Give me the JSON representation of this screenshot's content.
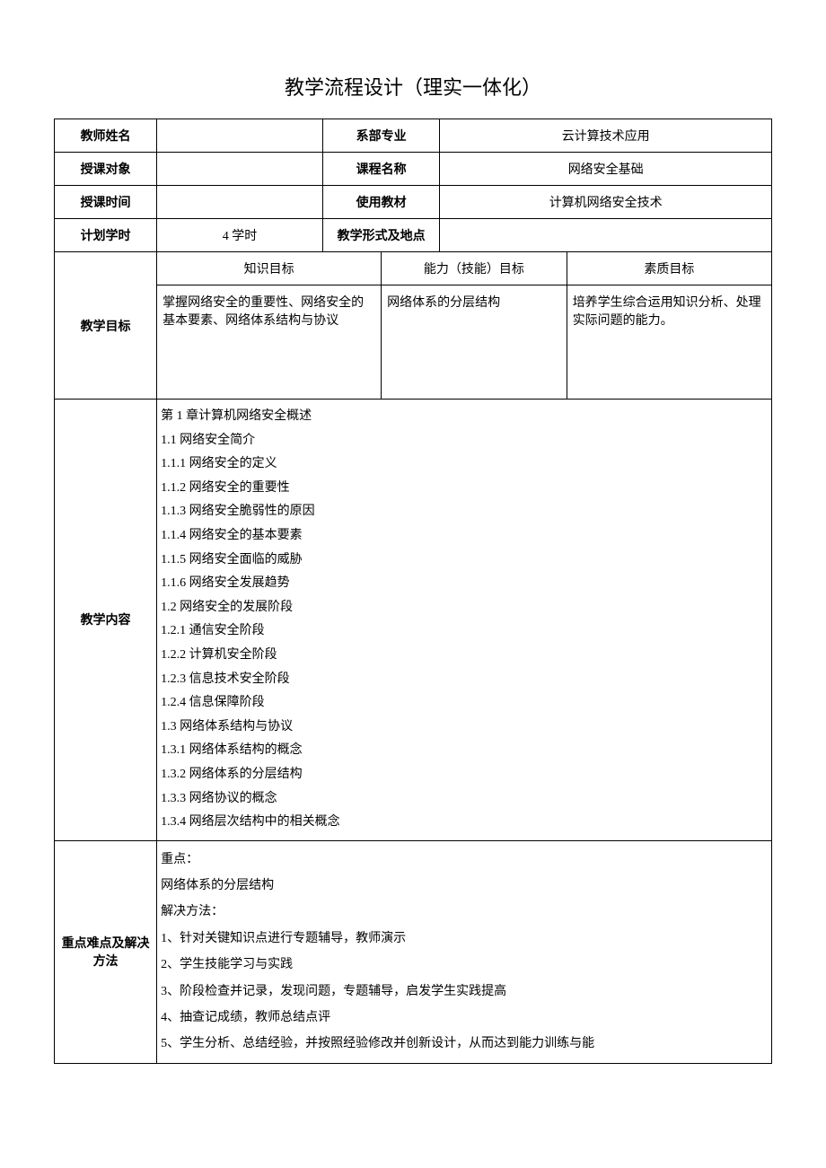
{
  "title": "教学流程设计（理实一体化）",
  "rows": {
    "r1": {
      "label": "教师姓名",
      "v1": "",
      "k2": "系部专业",
      "v2": "云计算技术应用"
    },
    "r2": {
      "label": "授课对象",
      "v1": "",
      "k2": "课程名称",
      "v2": "网络安全基础"
    },
    "r3": {
      "label": "授课时间",
      "v1": "",
      "k2": "使用教材",
      "v2": "计算机网络安全技术"
    },
    "r4": {
      "label": "计划学时",
      "v1": "4 学时",
      "k2": "教学形式及地点",
      "v2": ""
    }
  },
  "goals": {
    "label": "教学目标",
    "h1": "知识目标",
    "h2": "能力（技能）目标",
    "h3": "素质目标",
    "c1": "掌握网络安全的重要性、网络安全的基本要素、网络体系结构与协议",
    "c2": "网络体系的分层结构",
    "c3": "培养学生综合运用知识分析、处理实际问题的能力。"
  },
  "content": {
    "label": "教学内容",
    "text": "第 1 章计算机网络安全概述\n1.1   网络安全简介\n1.1.1  网络安全的定义\n1.1.2  网络安全的重要性\n1.1.3  网络安全脆弱性的原因\n1.1.4  网络安全的基本要素\n1.1.5  网络安全面临的威胁\n1.1.6  网络安全发展趋势\n1.2   网络安全的发展阶段\n1.2.1  通信安全阶段\n1.2.2  计算机安全阶段\n1.2.3  信息技术安全阶段\n1.2.4  信息保障阶段\n1.3   网络体系结构与协议\n1.3.1  网络体系结构的概念\n1.3.2  网络体系的分层结构\n1.3.3  网络协议的概念\n1.3.4  网络层次结构中的相关概念"
  },
  "keypoints": {
    "label": "重点难点及解决方法",
    "text": "重点：\n网络体系的分层结构\n解决方法：\n1、针对关键知识点进行专题辅导，教师演示\n2、学生技能学习与实践\n3、阶段检查并记录，发现问题，专题辅导，启发学生实践提高\n4、抽查记成绩，教师总结点评\n5、学生分析、总结经验，并按照经验修改并创新设计，从而达到能力训练与能"
  }
}
